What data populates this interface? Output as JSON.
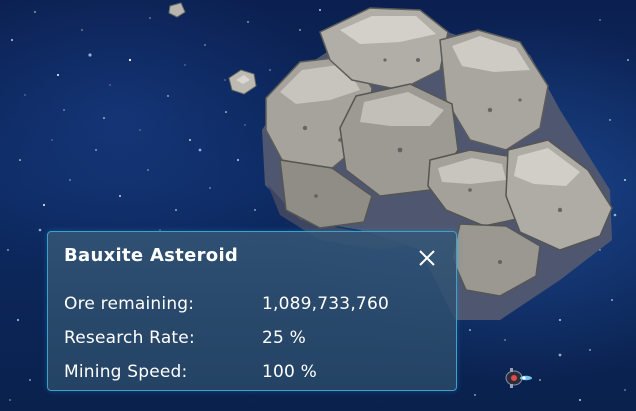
{
  "info_panel": {
    "title": "Bauxite Asteroid",
    "close_icon": "close-x-icon",
    "stats": [
      {
        "label": "Ore remaining:",
        "value": "1,089,733,760"
      },
      {
        "label": "Research Rate:",
        "value": "25 %"
      },
      {
        "label": "Mining Speed:",
        "value": "100 %"
      }
    ]
  },
  "colors": {
    "space_background": "#0d2a62",
    "panel_border": "#3fa0c8",
    "panel_fill": "#345676",
    "text": "#ffffff",
    "asteroid_rock": "#a9a9a4"
  }
}
